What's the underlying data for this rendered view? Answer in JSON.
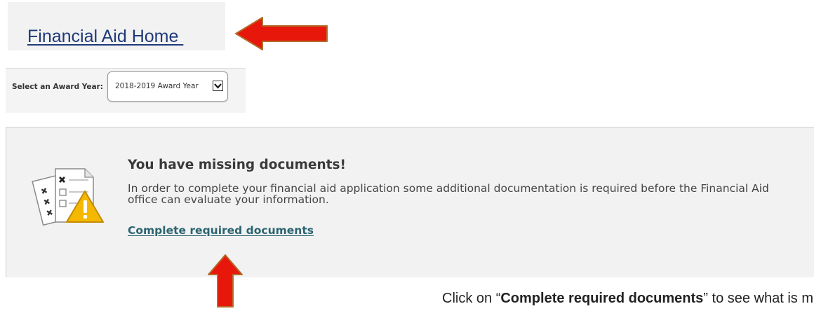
{
  "header": {
    "home_link_label": "Financial Aid Home "
  },
  "award_year": {
    "label": "Select an Award Year:",
    "selected_value": "2018-2019 Award Year"
  },
  "alert": {
    "icon": "missing-documents-warning-icon",
    "title": "You have missing documents!",
    "message": "In order to complete your financial aid application some additional documentation is required before the Financial Aid office can evaluate your information.",
    "link_label": "Complete required documents"
  },
  "annotation": {
    "prefix": "Click on “",
    "emphasis": "Complete required documents",
    "suffix": "” to see what is missing.",
    "arrow_color": "#e8170c"
  },
  "colors": {
    "link_blue": "#1f3a7a",
    "link_teal": "#2c6470",
    "warning_yellow": "#f5b800",
    "panel_gray": "#f2f2f2"
  }
}
